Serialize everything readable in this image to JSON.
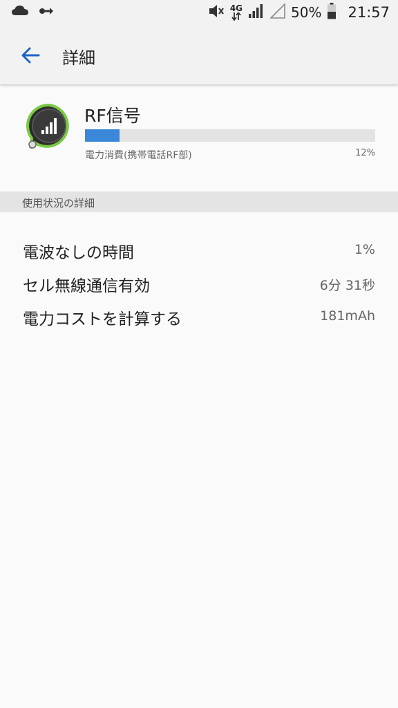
{
  "status_bar": {
    "left_icons": [
      "cloud-icon",
      "key-icon"
    ],
    "right_icons": [
      "mute-icon",
      "network-4g-icon",
      "signal-icon",
      "signal-empty-icon",
      "battery-icon"
    ],
    "network_label": "4G",
    "battery_percent": "50%",
    "time": "21:57"
  },
  "app_bar": {
    "back_icon": "arrow-back-icon",
    "title": "詳細"
  },
  "app_info": {
    "icon": "rf-signal-icon",
    "name": "RF信号",
    "usage_fraction": 0.12,
    "usage_caption": "電力消費(携帯電話RF部)",
    "usage_percent": "12%",
    "accent": "#3b87d8"
  },
  "section": {
    "title": "使用状況の詳細"
  },
  "details": [
    {
      "label": "電波なしの時間",
      "value": "1%"
    },
    {
      "label": "セル無線通信有効",
      "value": "6分 31秒"
    },
    {
      "label": "電力コストを計算する",
      "value": "181mAh"
    }
  ]
}
